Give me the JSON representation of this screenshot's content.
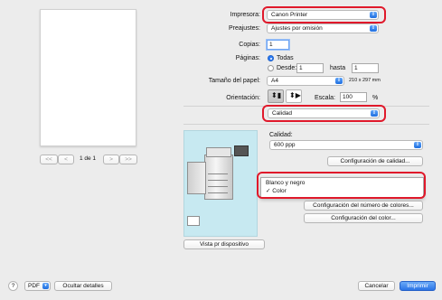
{
  "preview": {
    "page_indicator": "1 de 1",
    "first_btn": "<<",
    "prev_btn": "<",
    "next_btn": ">",
    "last_btn": ">>"
  },
  "printer": {
    "label": "Impresora:",
    "value": "Canon Printer"
  },
  "presets": {
    "label": "Preajustes:",
    "value": "Ajustes por omisión"
  },
  "copies": {
    "label": "Copias:",
    "value": "1"
  },
  "pages": {
    "label": "Páginas:",
    "all": "Todas",
    "from_label": "Desde:",
    "from_value": "1",
    "to_label": "hasta",
    "to_value": "1"
  },
  "paper_size": {
    "label": "Tamaño del papel:",
    "value": "A4",
    "dimensions": "210 x 297 mm"
  },
  "orientation": {
    "label": "Orientación:",
    "scale_label": "Escala:",
    "scale_value": "100",
    "percent": "%"
  },
  "section": {
    "value": "Calidad"
  },
  "quality": {
    "label": "Calidad:",
    "resolution": "600 ppp",
    "quality_settings_button": "Configuración de calidad...",
    "color_mode_menu": [
      "Blanco y negro",
      "✓ Color"
    ],
    "color_count_button": "Configuración del número de colores...",
    "color_settings_button": "Configuración del color...",
    "printer_view_button": "Vista pr dispositivo"
  },
  "footer": {
    "help": "?",
    "pdf": "PDF",
    "hide_details": "Ocultar detalles",
    "cancel": "Cancelar",
    "print": "Imprimir"
  },
  "colors": {
    "accent": "#2e6fe4",
    "highlight": "#e0192b"
  }
}
